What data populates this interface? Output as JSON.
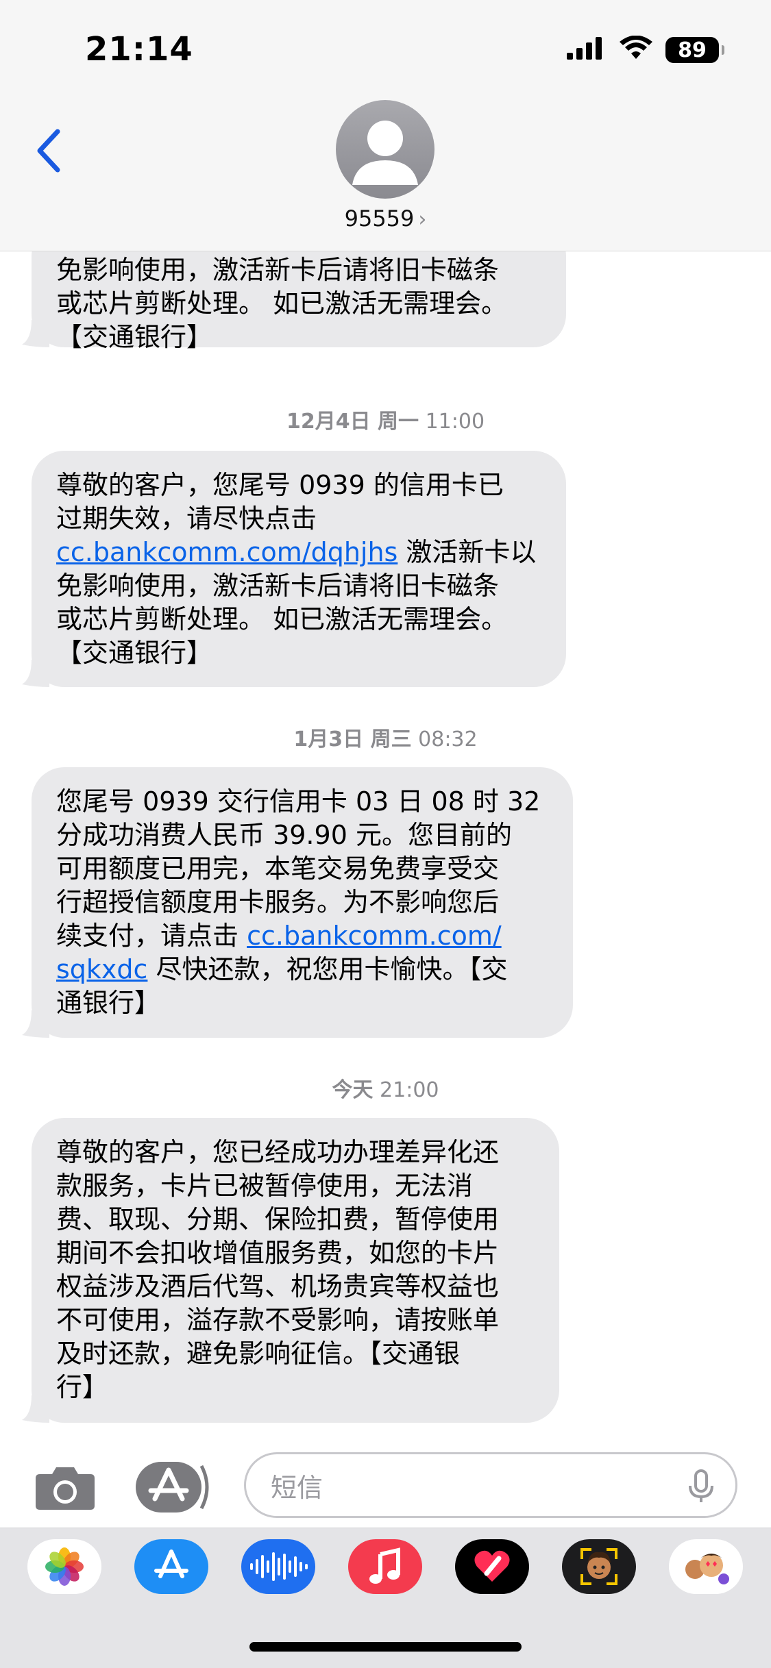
{
  "status_bar": {
    "time": "21:14",
    "battery": "89"
  },
  "header": {
    "contact": "95559",
    "chevron": "›"
  },
  "messages": [
    {
      "lines": [
        "免影响使用，激活新卡后请将旧卡磁条",
        "或芯片剪断处理。 如已激活无需理会。",
        "【交通银行】"
      ]
    },
    {
      "lines_a": "尊敬的客户，您尾号 0939 的信用卡已",
      "lines_b": "过期失效，请尽快点击",
      "link": "cc.bankcomm.com/dqhjhs",
      "after_link": " 激活新卡以",
      "lines_c": "免影响使用，激活新卡后请将旧卡磁条",
      "lines_d": "或芯片剪断处理。 如已激活无需理会。",
      "lines_e": "【交通银行】"
    },
    {
      "line1": "您尾号 0939 交行信用卡 03 日 08 时 32",
      "line2": "分成功消费人民币 39.90 元。您目前的",
      "line3": "可用额度已用完，本笔交易免费享受交",
      "line4": "行超授信额度用卡服务。为不影响您后",
      "line5_pre": "续支付，请点击 ",
      "link1": "cc.bankcomm.com/",
      "link2": "sqkxdc",
      "line6_post": " 尽快还款，祝您用卡愉快。【交",
      "line7": "通银行】"
    },
    {
      "lines": [
        "尊敬的客户，您已经成功办理差异化还",
        "款服务，卡片已被暂停使用，无法消",
        "费、取现、分期、保险扣费，暂停使用",
        "期间不会扣收增值服务费，如您的卡片",
        "权益涉及酒后代驾、机场贵宾等权益也",
        "不可使用，溢存款不受影响，请按账单",
        "及时还款，避免影响征信。【交通银",
        "行】"
      ]
    }
  ],
  "dates": [
    {
      "day": "12月4日 周一",
      "time": "11:00"
    },
    {
      "day": "1月3日 周三",
      "time": "08:32"
    },
    {
      "day": "今天",
      "time": "21:00"
    }
  ],
  "composer": {
    "placeholder": "短信"
  },
  "colors": {
    "bubble": "#e9e9eb",
    "link": "#0a63e8",
    "back": "#1a5ae0"
  }
}
